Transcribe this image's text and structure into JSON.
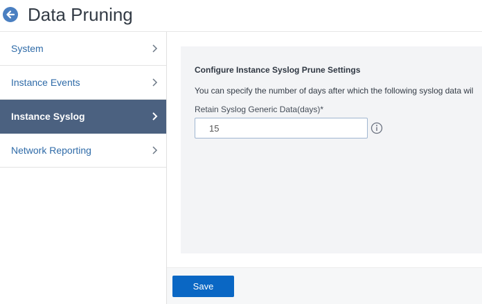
{
  "header": {
    "title": "Data Pruning",
    "back_icon": "back-arrow-icon"
  },
  "sidebar": {
    "items": [
      {
        "label": "System",
        "active": false
      },
      {
        "label": "Instance Events",
        "active": false
      },
      {
        "label": "Instance Syslog",
        "active": true
      },
      {
        "label": "Network Reporting",
        "active": false
      }
    ]
  },
  "main": {
    "section_title": "Configure Instance Syslog Prune Settings",
    "description": "You can specify the number of days after which the following syslog data wil",
    "field_label": "Retain Syslog Generic Data(days)*",
    "field_value": "15",
    "info_icon": "info-icon"
  },
  "footer": {
    "save_label": "Save"
  },
  "colors": {
    "accent": "#0a67c4",
    "active_nav": "#4b6180",
    "link": "#2f6ba8",
    "panel_bg": "#f3f4f6"
  }
}
